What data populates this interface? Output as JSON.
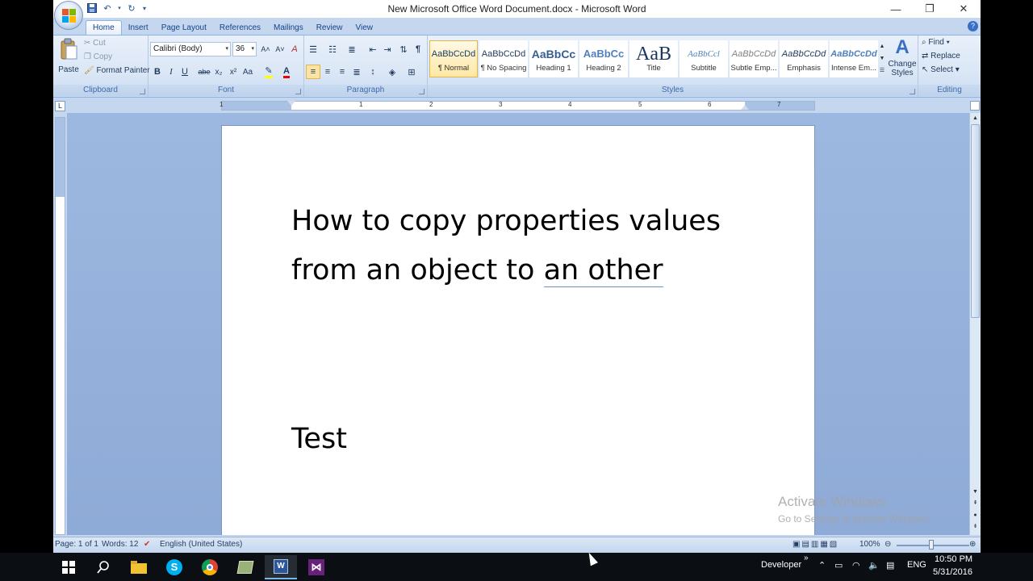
{
  "window": {
    "title": "New Microsoft Office Word Document.docx - Microsoft Word",
    "controls": [
      "—",
      "❐",
      "✕"
    ]
  },
  "tabs": [
    "Home",
    "Insert",
    "Page Layout",
    "References",
    "Mailings",
    "Review",
    "View"
  ],
  "clipboard": {
    "paste": "Paste",
    "cut": "Cut",
    "copy": "Copy",
    "format_painter": "Format Painter",
    "label": "Clipboard"
  },
  "font": {
    "name": "Calibri (Body)",
    "size": "36",
    "label": "Font",
    "bold": "B",
    "italic": "I",
    "underline": "U",
    "strike": "abe",
    "sub": "x₂",
    "sup": "x²",
    "case": "Aa",
    "grow": "A˄",
    "shrink": "A˅",
    "clear": "A"
  },
  "paragraph": {
    "label": "Paragraph"
  },
  "styles": {
    "label": "Styles",
    "items": [
      {
        "sample": "AaBbCcDd",
        "name": "¶ Normal"
      },
      {
        "sample": "AaBbCcDd",
        "name": "¶ No Spacing"
      },
      {
        "sample": "AaBbCc",
        "name": "Heading 1"
      },
      {
        "sample": "AaBbCc",
        "name": "Heading 2"
      },
      {
        "sample": "AaB",
        "name": "Title"
      },
      {
        "sample": "AaBbCcl",
        "name": "Subtitle"
      },
      {
        "sample": "AaBbCcDd",
        "name": "Subtle Emp..."
      },
      {
        "sample": "AaBbCcDd",
        "name": "Emphasis"
      },
      {
        "sample": "AaBbCcDd",
        "name": "Intense Em..."
      }
    ],
    "change_styles_1": "Change",
    "change_styles_2": "Styles"
  },
  "editing": {
    "find": "Find",
    "replace": "Replace",
    "select": "Select",
    "label": "Editing"
  },
  "ruler_numbers": [
    "1",
    "1",
    "2",
    "3",
    "4",
    "5",
    "6",
    "7"
  ],
  "document": {
    "line1": "How to copy properties values",
    "line2a": "from an object to ",
    "line2b": "an other",
    "test": "Test"
  },
  "watermark": {
    "line1": "Activate Windows",
    "line2": "Go to Settings to activate Windows."
  },
  "status": {
    "page": "Page: 1 of 1",
    "words": "Words: 12",
    "language": "English (United States)",
    "zoom": "100%"
  },
  "taskbar": {
    "developer": "Developer",
    "lang": "ENG",
    "time": "10:50 PM",
    "date": "5/31/2016"
  }
}
